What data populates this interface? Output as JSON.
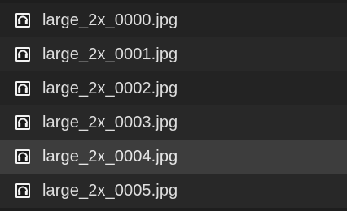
{
  "file_list": {
    "items": [
      {
        "name": "large_2x_0000.jpg",
        "icon": "image-file-icon",
        "selected": false
      },
      {
        "name": "large_2x_0001.jpg",
        "icon": "image-file-icon",
        "selected": false
      },
      {
        "name": "large_2x_0002.jpg",
        "icon": "image-file-icon",
        "selected": false
      },
      {
        "name": "large_2x_0003.jpg",
        "icon": "image-file-icon",
        "selected": false
      },
      {
        "name": "large_2x_0004.jpg",
        "icon": "image-file-icon",
        "selected": true
      },
      {
        "name": "large_2x_0005.jpg",
        "icon": "image-file-icon",
        "selected": false
      }
    ]
  },
  "colors": {
    "background": "#1e1e1e",
    "row_even": "#232323",
    "row_odd": "#282828",
    "row_selected": "#3d3d3d",
    "text": "#dedede"
  }
}
